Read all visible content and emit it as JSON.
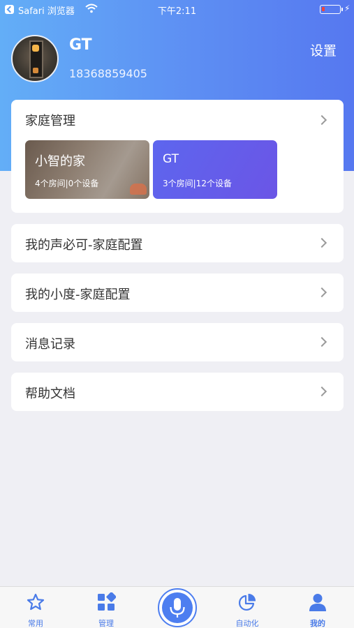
{
  "status_bar": {
    "carrier": "Safari 浏览器",
    "time": "下午2:11"
  },
  "profile": {
    "name": "GT",
    "phone": "18368859405",
    "settings_label": "设置"
  },
  "family_card": {
    "title": "家庭管理",
    "homes": [
      {
        "name": "小智的家",
        "stats": "4个房间|0个设备"
      },
      {
        "name": "GT",
        "stats": "3个房间|12个设备"
      }
    ]
  },
  "menu": [
    {
      "label": "我的声必可-家庭配置"
    },
    {
      "label": "我的小度-家庭配置"
    },
    {
      "label": "消息记录"
    },
    {
      "label": "帮助文档"
    }
  ],
  "tab_bar": {
    "tabs": [
      {
        "label": "常用",
        "icon": "star-icon"
      },
      {
        "label": "管理",
        "icon": "grid-icon"
      },
      {
        "label": "",
        "icon": "microphone-icon"
      },
      {
        "label": "自动化",
        "icon": "pie-chart-icon"
      },
      {
        "label": "我的",
        "icon": "person-icon"
      }
    ],
    "active": "我的"
  },
  "colors": {
    "accent": "#4d7ef0",
    "header_gradient_start": "#63aef7",
    "header_gradient_end": "#5678f0",
    "background": "#efeff4",
    "tile_purple": "#6b55e6"
  }
}
